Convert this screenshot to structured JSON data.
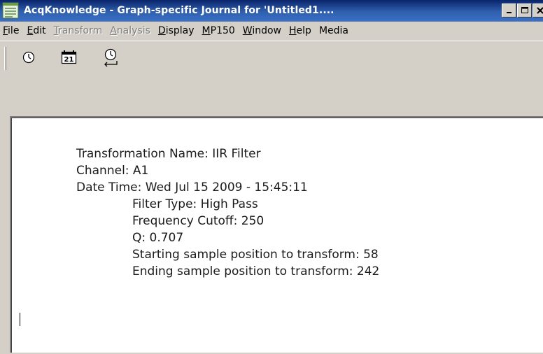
{
  "window": {
    "title": "AcqKnowledge - Graph-specific Journal for 'Untitled1....",
    "app_icon": "acqknowledge-app-icon",
    "title_buttons": [
      {
        "name": "minimize-button",
        "icon": "minimize-icon"
      },
      {
        "name": "maximize-button",
        "icon": "maximize-icon"
      },
      {
        "name": "close-button",
        "icon": "close-icon"
      }
    ]
  },
  "menubar": {
    "items": [
      {
        "label": "File",
        "enabled": true
      },
      {
        "label": "Edit",
        "enabled": true
      },
      {
        "label": "Transform",
        "enabled": false
      },
      {
        "label": "Analysis",
        "enabled": false
      },
      {
        "label": "Display",
        "enabled": true
      },
      {
        "label": "MP150",
        "enabled": true
      },
      {
        "label": "Window",
        "enabled": true
      },
      {
        "label": "Help",
        "enabled": true
      },
      {
        "label": "Media",
        "enabled": true
      }
    ]
  },
  "toolbar": {
    "buttons": [
      {
        "name": "insert-time-button",
        "icon": "clock-icon"
      },
      {
        "name": "insert-date-button",
        "icon": "calendar-icon"
      },
      {
        "name": "insert-date-time-button",
        "icon": "clock-return-icon"
      }
    ]
  },
  "journal": {
    "transformation_name": "Transformation Name: IIR Filter",
    "channel": "Channel: A1",
    "date_time": "Date Time: Wed Jul 15 2009 - 15:45:11",
    "filter_type": "Filter Type: High Pass",
    "frequency_cutoff": "Frequency Cutoff: 250",
    "q": "Q: 0.707",
    "start_sample": "Starting sample position to transform: 58",
    "end_sample": "Ending sample position to transform: 242"
  },
  "colors": {
    "title_bar_start": "#0a246a",
    "title_bar_end": "#3a6fc4",
    "chrome": "#d4d0c8",
    "disabled_text": "#808080"
  }
}
